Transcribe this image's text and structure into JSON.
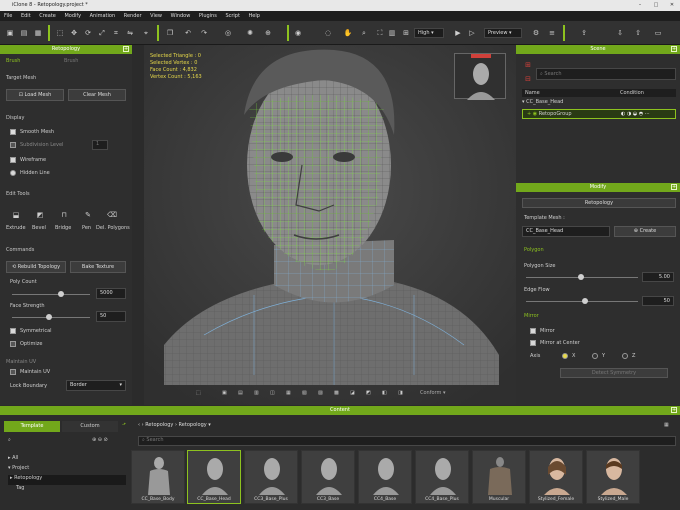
{
  "window": {
    "title": "iClone 8 - Retopology.project *"
  },
  "menu": [
    "File",
    "Edit",
    "Create",
    "Modify",
    "Animation",
    "Render",
    "View",
    "Window",
    "Plugins",
    "Script",
    "Help"
  ],
  "toolbar": {
    "quality": "High",
    "preview": "Preview"
  },
  "left": {
    "header": "Retopology",
    "tabs": [
      "Brush",
      "Brush"
    ],
    "target_mesh": {
      "title": "Target Mesh",
      "load": "Load Mesh",
      "clear": "Clear Mesh"
    },
    "display": {
      "title": "Display",
      "smooth": "Smooth Mesh",
      "subdiv": "Subdivision Level",
      "subdiv_val": "1",
      "wireframe": "Wireframe",
      "hidden": "Hidden Line"
    },
    "edit": {
      "title": "Edit Tools",
      "tools": [
        "Extrude",
        "Bevel",
        "Bridge",
        "Pen",
        "Del. Polygons"
      ]
    },
    "commands": {
      "title": "Commands",
      "rebuild": "Rebuild Topology",
      "bake": "Bake Texture",
      "poly_label": "Poly Count",
      "poly_val": "5000",
      "face_label": "Face Strength",
      "face_val": "50",
      "symmetrical": "Symmetrical",
      "optimize": "Optimize"
    },
    "uv": {
      "title": "Maintain UV",
      "maintain": "Maintain UV",
      "lock": "Lock Boundary",
      "lock_val": "Border"
    }
  },
  "hud": {
    "line1": "Selected Triangle : 0",
    "line2": "Selected Vertex : 0",
    "line3": "Face Count : 4,832",
    "line4": "Vertex Count : 5,163"
  },
  "viewport_bottom": {
    "mode": "Conform"
  },
  "scene": {
    "header": "Scene",
    "search": "Search",
    "col_name": "Name",
    "col_cond": "Condition",
    "row1": "CC_Base_Head",
    "row2": "RetopoGroup"
  },
  "modify": {
    "header": "Modify",
    "tab": "Retopology",
    "template_label": "Template Mesh :",
    "template_val": "CC_Base_Head",
    "create": "Create",
    "polygon_title": "Polygon",
    "poly_size": "Polygon Size",
    "poly_size_val": "5.00",
    "edge_flow": "Edge Flow",
    "edge_flow_val": "50",
    "mirror_title": "Mirror",
    "mirror": "Mirror",
    "mirror_center": "Mirror at Center",
    "axis": "Axis",
    "x": "X",
    "y": "Y",
    "z": "Z",
    "detect": "Detect Symmetry"
  },
  "content": {
    "header": "Content",
    "tab_template": "Template",
    "tab_custom": "Custom",
    "path1": "Retopology",
    "path2": "Retopology",
    "search": "Search",
    "tree": [
      "All",
      "Project",
      "Retopology",
      "Tag"
    ],
    "items": [
      "CC_Base_Body",
      "CC_Base_Head",
      "CC3_Base_Plus",
      "CC3_Base",
      "CC4_Base",
      "CC4_Base_Plus",
      "Muscular",
      "Stylized_Female",
      "Stylized_Male"
    ]
  },
  "colors": {
    "accent": "#72a81b",
    "wire": "#7de23a"
  }
}
